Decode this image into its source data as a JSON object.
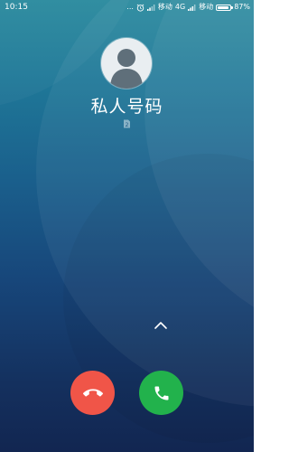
{
  "status_bar": {
    "time": "10:15",
    "dots": "...",
    "carrier_1": "移动",
    "network_1": "4G",
    "carrier_2": "移动",
    "battery_percent": "87%",
    "battery_level": 0.87
  },
  "caller": {
    "name": "私人号码",
    "avatar_icon": "person-silhouette-icon",
    "sim_icon": "sim-2-icon",
    "sim_label": "2"
  },
  "actions": {
    "swipe_hint_icon": "chevron-up-icon",
    "decline_icon": "phone-hangup-icon",
    "answer_icon": "phone-answer-icon"
  },
  "colors": {
    "decline": "#f05548",
    "answer": "#22b24c",
    "background_top": "#2a8a9e",
    "background_bottom": "#122651"
  }
}
